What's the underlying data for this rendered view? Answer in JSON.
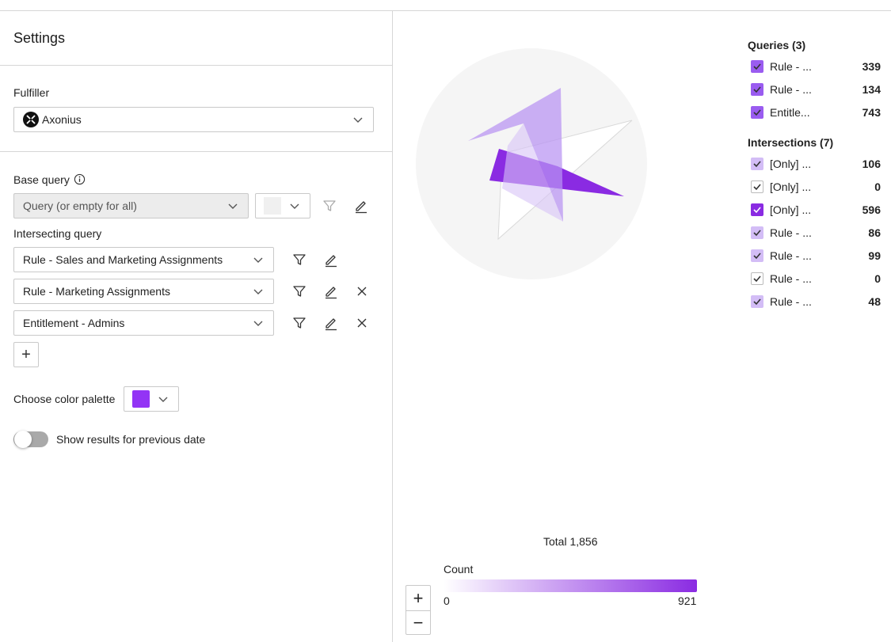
{
  "settings": {
    "title": "Settings",
    "fulfiller": {
      "label": "Fulfiller",
      "value": "Axonius"
    },
    "base_query": {
      "label": "Base query",
      "placeholder": "Query (or empty for all)"
    },
    "intersecting": {
      "label": "Intersecting query",
      "queries": [
        "Rule - Sales and Marketing Assignments",
        "Rule - Marketing Assignments",
        "Entitlement - Admins"
      ],
      "add_label": "+"
    },
    "palette": {
      "label": "Choose color palette",
      "color": "#9334f5"
    },
    "previous_date": {
      "label": "Show results for previous date",
      "enabled": false
    }
  },
  "chart": {
    "queries_title": "Queries (3)",
    "queries": [
      {
        "label": "Rule - ...",
        "value": "339",
        "color": "#9a5cf0"
      },
      {
        "label": "Rule - ...",
        "value": "134",
        "color": "#9a5cf0"
      },
      {
        "label": "Entitle...",
        "value": "743",
        "color": "#9a5cf0"
      }
    ],
    "intersections_title": "Intersections (7)",
    "intersections": [
      {
        "label": "[Only] ...",
        "value": "106",
        "color": "#d3bdf6"
      },
      {
        "label": "[Only] ...",
        "value": "0",
        "color": "#ffffff"
      },
      {
        "label": "[Only] ...",
        "value": "596",
        "color": "#8a2be2"
      },
      {
        "label": "Rule - ...",
        "value": "86",
        "color": "#d3bdf6"
      },
      {
        "label": "Rule - ...",
        "value": "99",
        "color": "#d3bdf6"
      },
      {
        "label": "Rule - ...",
        "value": "0",
        "color": "#ffffff"
      },
      {
        "label": "Rule - ...",
        "value": "48",
        "color": "#d3bdf6"
      }
    ],
    "total": "Total 1,856",
    "count_label": "Count",
    "count_min": "0",
    "count_max": "921",
    "zoom_in": "+",
    "zoom_out": "−"
  }
}
